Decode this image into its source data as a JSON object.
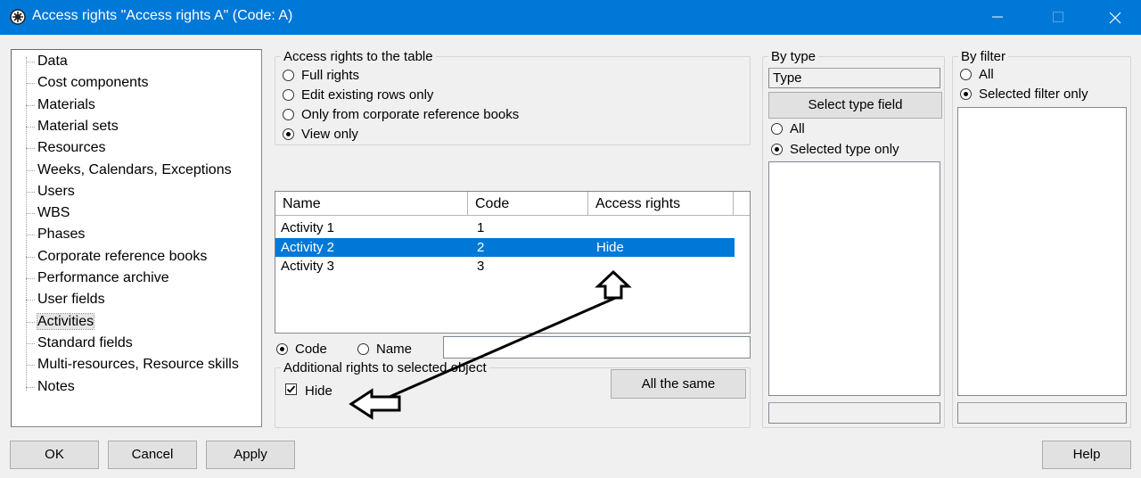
{
  "window": {
    "title": "Access rights \"Access rights A\" (Code: A)"
  },
  "tree": {
    "items": [
      "Data",
      "Cost components",
      "Materials",
      "Material sets",
      "Resources",
      "Weeks, Calendars, Exceptions",
      "Users",
      "WBS",
      "Phases",
      "Corporate reference books",
      "Performance archive",
      "User fields",
      "Activities",
      "Standard fields",
      "Multi-resources, Resource skills",
      "Notes"
    ],
    "selected_index": 12
  },
  "access_table": {
    "legend": "Access rights to the table",
    "options": [
      "Full rights",
      "Edit existing rows only",
      "Only from corporate reference books",
      "View only"
    ],
    "selected_index": 3
  },
  "list": {
    "columns": [
      "Name",
      "Code",
      "Access rights"
    ],
    "rows": [
      {
        "name": "Activity 1",
        "code": "1",
        "rights": ""
      },
      {
        "name": "Activity 2",
        "code": "2",
        "rights": "Hide"
      },
      {
        "name": "Activity 3",
        "code": "3",
        "rights": ""
      }
    ],
    "selected_index": 1
  },
  "search": {
    "code_label": "Code",
    "name_label": "Name",
    "selected": "Code",
    "value": ""
  },
  "additional": {
    "legend": "Additional rights to selected object",
    "hide_label": "Hide",
    "hide_checked": true,
    "all_same_label": "All the same"
  },
  "by_type": {
    "legend": "By type",
    "field_value": "Type",
    "select_button": "Select type field",
    "all_label": "All",
    "selected_only_label": "Selected type only",
    "selected": "Selected type only",
    "status": ""
  },
  "by_filter": {
    "legend": "By filter",
    "all_label": "All",
    "selected_only_label": "Selected filter only",
    "selected": "Selected filter only",
    "status": ""
  },
  "buttons": {
    "ok": "OK",
    "cancel": "Cancel",
    "apply": "Apply",
    "help": "Help"
  },
  "colors": {
    "titlebar": "#0078d7",
    "selection": "#0078d7"
  }
}
